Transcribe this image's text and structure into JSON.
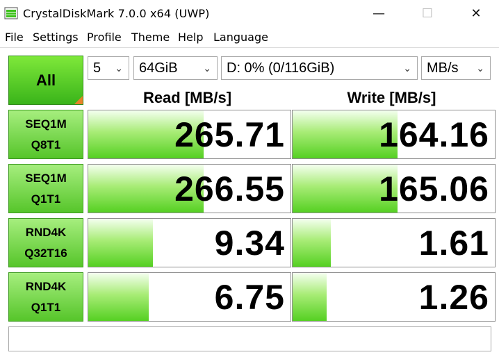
{
  "window": {
    "title": "CrystalDiskMark 7.0.0 x64 (UWP)",
    "minimize_glyph": "—",
    "maximize_glyph": "☐",
    "close_glyph": "✕"
  },
  "menu": [
    "File",
    "Settings",
    "Profile",
    "Theme",
    "Help",
    "Language"
  ],
  "controls": {
    "all_label": "All",
    "count": "5",
    "size": "64GiB",
    "drive": "D: 0% (0/116GiB)",
    "unit": "MB/s"
  },
  "headers": {
    "read": "Read [MB/s]",
    "write": "Write [MB/s]"
  },
  "tests": [
    {
      "line1": "SEQ1M",
      "line2": "Q8T1",
      "read": "265.71",
      "write": "164.16",
      "read_fill": 0.57,
      "write_fill": 0.52
    },
    {
      "line1": "SEQ1M",
      "line2": "Q1T1",
      "read": "266.55",
      "write": "165.06",
      "read_fill": 0.57,
      "write_fill": 0.52
    },
    {
      "line1": "RND4K",
      "line2": "Q32T16",
      "read": "9.34",
      "write": "1.61",
      "read_fill": 0.32,
      "write_fill": 0.19
    },
    {
      "line1": "RND4K",
      "line2": "Q1T1",
      "read": "6.75",
      "write": "1.26",
      "read_fill": 0.3,
      "write_fill": 0.17
    }
  ],
  "comment": "",
  "colors": {
    "accent_green": "#55d022",
    "button_green": "#56c52a",
    "corner_orange": "#e8822a"
  }
}
